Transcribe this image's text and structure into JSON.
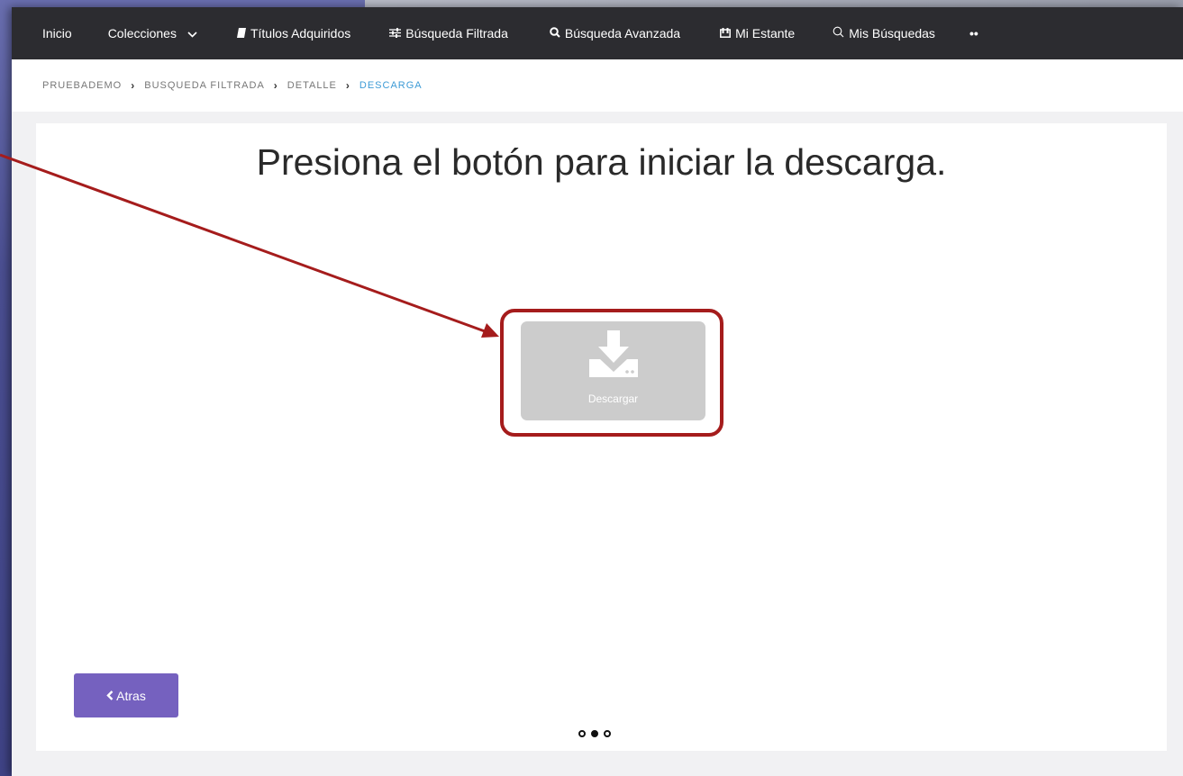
{
  "navbar": {
    "items": [
      {
        "label": "Inicio",
        "icon": ""
      },
      {
        "label": "Colecciones",
        "icon": "chevron-down-icon"
      },
      {
        "label": "Títulos Adquiridos",
        "icon": "book-icon"
      },
      {
        "label": "Búsqueda Filtrada",
        "icon": "sliders-icon"
      },
      {
        "label": "Búsqueda Avanzada",
        "icon": "search-icon"
      },
      {
        "label": "Mi Estante",
        "icon": "shelf-icon"
      },
      {
        "label": "Mis Búsquedas",
        "icon": "search-outline-icon"
      }
    ],
    "more": "••"
  },
  "breadcrumb": [
    "PRUEBADEMO",
    "BUSQUEDA FILTRADA",
    "DETALLE",
    "DESCARGA"
  ],
  "main": {
    "heading": "Presiona el botón para iniciar la descarga.",
    "download_label": "Descargar",
    "back_label": "Atras",
    "pager": {
      "total": 3,
      "active": 2
    }
  },
  "colors": {
    "navbar": "#2c2c30",
    "accent_link": "#3d9bd6",
    "back_button": "#7561bf",
    "download_button": "#cccccc",
    "annotation": "#a51c1c"
  }
}
